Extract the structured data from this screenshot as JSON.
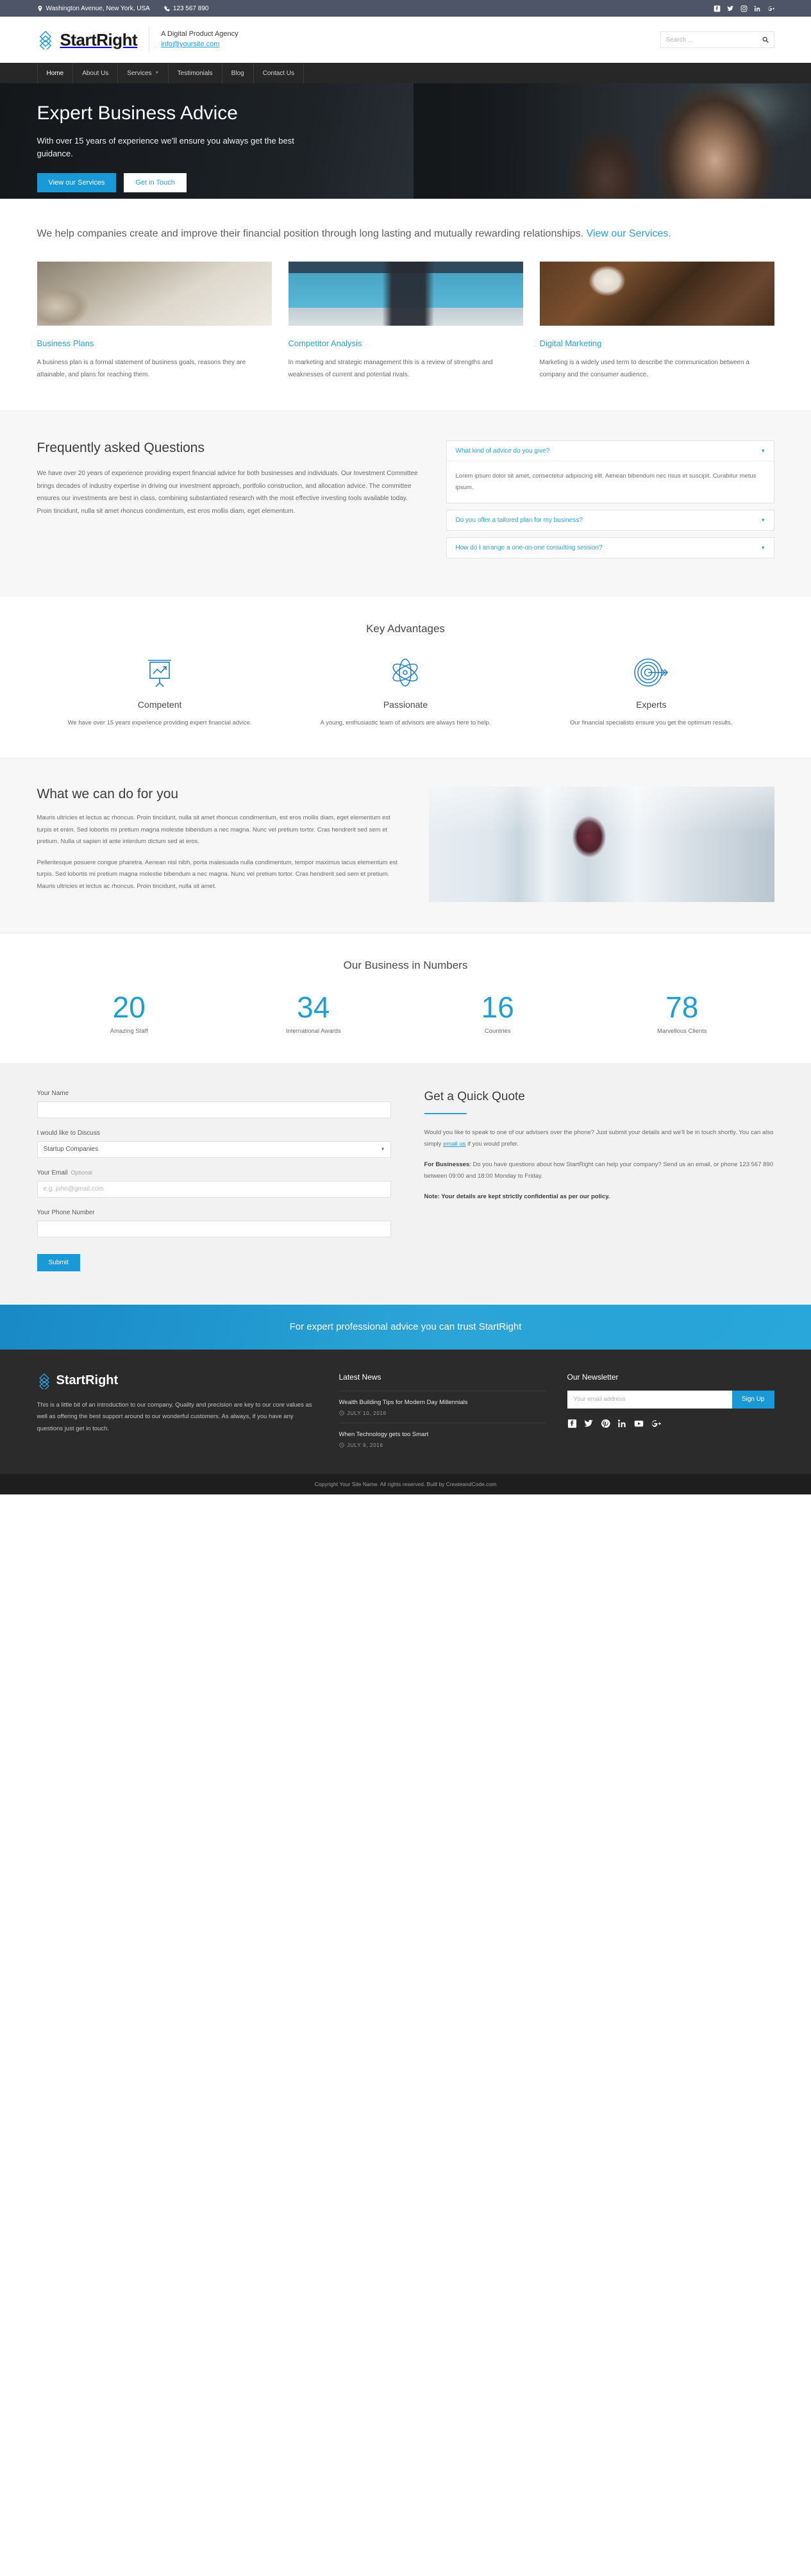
{
  "topbar": {
    "address": "Washington Avenue, New York, USA",
    "phone": "123 567 890",
    "socials": [
      "facebook-icon",
      "twitter-icon",
      "instagram-icon",
      "linkedin-icon",
      "googleplus-icon"
    ]
  },
  "header": {
    "brand": "StartRight",
    "tagline": "A Digital Product Agency",
    "email": "info@yoursite.com",
    "search_placeholder": "Search ..."
  },
  "nav": {
    "items": [
      {
        "label": "Home",
        "active": true,
        "dropdown": false
      },
      {
        "label": "About Us",
        "active": false,
        "dropdown": false
      },
      {
        "label": "Services",
        "active": false,
        "dropdown": true
      },
      {
        "label": "Testimonials",
        "active": false,
        "dropdown": false
      },
      {
        "label": "Blog",
        "active": false,
        "dropdown": false
      },
      {
        "label": "Contact Us",
        "active": false,
        "dropdown": false
      }
    ]
  },
  "hero": {
    "title": "Expert Business Advice",
    "subtitle": "With over 15 years of experience we'll ensure you always get the best guidance.",
    "primary_button": "View our Services",
    "secondary_button": "Get in Touch"
  },
  "intro": {
    "text": "We help companies create and improve their financial position through long lasting and mutually rewarding relationships. ",
    "link": "View our Services."
  },
  "cards": [
    {
      "title": "Business Plans",
      "body": "A business plan is a formal statement of business goals, reasons they are attainable, and plans for reaching them."
    },
    {
      "title": "Competitor Analysis",
      "body": "In marketing and strategic management this is a review of strengths and weaknesses of current and potential rivals."
    },
    {
      "title": "Digital Marketing",
      "body": "Marketing is a widely used term to describe the communication between a company and the consumer audience."
    }
  ],
  "faq": {
    "title": "Frequently asked Questions",
    "body": "We have over 20 years of experience providing expert financial advice for both businesses and individuals. Our Investment Committee brings decades of industry expertise in driving our investment approach, portfolio construction, and allocation advice. The committee ensures our investments are best in class, combining substantiated research with the most effective investing tools available today. Proin tincidunt, nulla sit amet rhoncus condimentum, est eros mollis diam, eget elementum.",
    "items": [
      {
        "question": "What kind of advice do you give?",
        "answer": "Lorem ipsum dolor sit amet, consectetur adipiscing elit. Aenean bibendum nec risus et suscipit. Curabitur metus ipsum.",
        "open": true
      },
      {
        "question": "Do you offer a tailored plan for my business?",
        "answer": "",
        "open": false
      },
      {
        "question": "How do I arrange a one-on-one consulting session?",
        "answer": "",
        "open": false
      }
    ]
  },
  "advantages": {
    "title": "Key Advantages",
    "items": [
      {
        "icon": "chart-growth-icon",
        "title": "Competent",
        "body": "We have over 15 years experience providing expert financial advice."
      },
      {
        "icon": "atom-icon",
        "title": "Passionate",
        "body": "A young, enthusiastic team of advisors are always here to help."
      },
      {
        "icon": "target-arrow-icon",
        "title": "Experts",
        "body": "Our financial specialists ensure you get the optimum results."
      }
    ]
  },
  "what_we_do": {
    "title": "What we can do for you",
    "paragraphs": [
      "Mauris ultricies et lectus ac rhoncus. Proin tincidunt, nulla sit amet rhoncus condimentum, est eros mollis diam, eget elementum est turpis et enim. Sed lobortis mi pretium magna molestie bibendum a nec magna. Nunc vel pretium tortor. Cras hendrerit sed sem et pretium. Nulla ut sapien id ante interdum dictum sed at eros.",
      "Pellentesque posuere congue pharetra. Aenean nisl nibh, porta malesuada nulla condimentum, tempor maximus lacus elementum est turpis. Sed lobortis mi pretium magna molestie bibendum a nec magna. Nunc vel pretium tortor. Cras hendrerit sed sem et pretium. Mauris ultricies et lectus ac rhoncus. Proin tincidunt, nulla sit amet."
    ]
  },
  "numbers": {
    "title": "Our Business in Numbers",
    "stats": [
      {
        "value": "20",
        "label": "Amazing Staff"
      },
      {
        "value": "34",
        "label": "International Awards"
      },
      {
        "value": "16",
        "label": "Countries"
      },
      {
        "value": "78",
        "label": "Marvellous Clients"
      }
    ]
  },
  "form": {
    "name_label": "Your Name",
    "name_value": "",
    "discuss_label": "I would like to Discuss",
    "discuss_value": "Startup Companies",
    "discuss_options": [
      "Startup Companies"
    ],
    "email_label": "Your Email",
    "email_optional": "Optional",
    "email_placeholder": "e.g. john@gmail.com",
    "phone_label": "Your Phone Number",
    "phone_value": "",
    "submit": "Submit"
  },
  "quote": {
    "title": "Get a Quick Quote",
    "p1_a": "Would you like to speak to one of our advisers over the phone? Just submit your details and we'll be in touch shortly. You can also simply ",
    "p1_link": "email us",
    "p1_b": " if you would prefer.",
    "p2_strong": "For Businesses",
    "p2": ": Do you have questions about how StartRight can help your company? Send us an email, or phone 123 567 890 between 09:00 and 18:00 Monday to Friday.",
    "p3": "Note: Your details are kept strictly confidential as per our policy."
  },
  "cta": {
    "text": "For expert professional advice you can trust StartRight"
  },
  "footer": {
    "brand": "StartRight",
    "about": "This is a little bit of an introduction to our company. Quality and precision are key to our core values as well as offering the best support around to our wonderful customers. As always, if you have any questions just get in touch.",
    "news_title": "Latest News",
    "news": [
      {
        "title": "Wealth Building Tips for Modern Day Millennials",
        "date": "JULY 10, 2016"
      },
      {
        "title": "When Technology gets too Smart",
        "date": "JULY 9, 2016"
      }
    ],
    "newsletter_title": "Our Newsletter",
    "newsletter_placeholder": "Your email address",
    "newsletter_button": "Sign Up",
    "socials": [
      "facebook-icon",
      "twitter-icon",
      "pinterest-icon",
      "linkedin-icon",
      "youtube-icon",
      "googleplus-icon"
    ]
  },
  "copyright": {
    "text": "Copyright Your Site Name. All rights reserved. Built by CreateandCode.com"
  },
  "colors": {
    "accent": "#199ad6",
    "link": "#2b9fd9",
    "dark": "#272727",
    "topbar": "#4e5566"
  }
}
